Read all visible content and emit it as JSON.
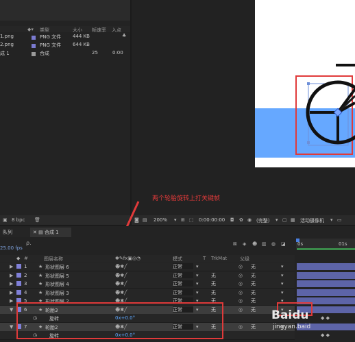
{
  "project": {
    "columns": {
      "type": "类型",
      "size": "大小",
      "fps": "帧速率",
      "in": "入点"
    },
    "items": [
      {
        "name": "1.png",
        "type": "PNG 文件",
        "size": "444 KB",
        "fps": "",
        "in": ""
      },
      {
        "name": "2.png",
        "type": "PNG 文件",
        "size": "644 KB",
        "fps": "",
        "in": ""
      },
      {
        "name": "成 1",
        "type": "合成",
        "size": "",
        "fps": "25",
        "in": "0:00"
      }
    ],
    "bpc": "8 bpc"
  },
  "viewer": {
    "zoom": "200%",
    "timecode": "0:00:00:00",
    "view_mode": "(完整)",
    "camera": "活动摄像机"
  },
  "annotation": {
    "text": "两个轮胎旋转上打关键帧",
    "color": "#e03a3a"
  },
  "timeline": {
    "tabs": [
      "队列",
      "合成 1"
    ],
    "fps_label": "25.00 fps",
    "search_placeholder": "ρ.",
    "columns": {
      "num": "#",
      "name": "图层名称",
      "mode": "模式",
      "t": "T",
      "trkmat": "TrkMat",
      "parent": "父级"
    },
    "layers": [
      {
        "num": "1",
        "name": "形状图层 6",
        "mode": "正常",
        "trkmat": "",
        "parent": "无"
      },
      {
        "num": "2",
        "name": "形状图层 5",
        "mode": "正常",
        "trkmat": "无",
        "parent": "无"
      },
      {
        "num": "3",
        "name": "形状图层 4",
        "mode": "正常",
        "trkmat": "无",
        "parent": "无"
      },
      {
        "num": "4",
        "name": "形状图层 3",
        "mode": "正常",
        "trkmat": "无",
        "parent": "无"
      },
      {
        "num": "5",
        "name": "形状图层 2",
        "mode": "正常",
        "trkmat": "无",
        "parent": "无"
      },
      {
        "num": "6",
        "name": "轮胎3",
        "mode": "正常",
        "trkmat": "无",
        "parent": "无"
      },
      {
        "num": "7",
        "name": "轮胎2",
        "mode": "正常",
        "trkmat": "无",
        "parent": "无"
      }
    ],
    "rotation_label": "旋转",
    "rotation_value": "0x+0.0°",
    "ruler": [
      "0s",
      "01s"
    ]
  },
  "watermark": {
    "text": "Baidu",
    "sub": "jingyan.baid"
  }
}
